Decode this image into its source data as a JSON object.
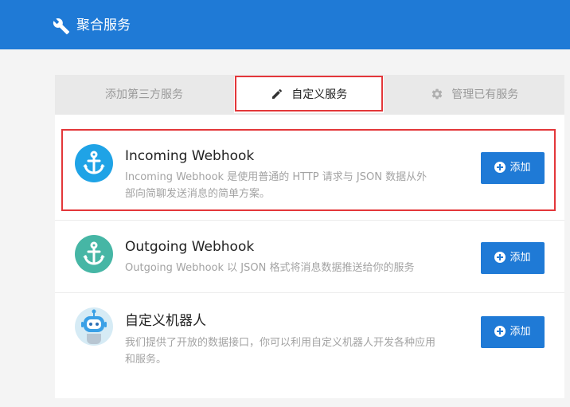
{
  "header": {
    "title": "聚合服务",
    "icon": "wrench-icon"
  },
  "tabs": [
    {
      "label": "添加第三方服务",
      "active": false
    },
    {
      "label": "自定义服务",
      "active": true,
      "icon": "pencil-icon"
    },
    {
      "label": "管理已有服务",
      "active": false,
      "icon": "gear-icon"
    }
  ],
  "services": [
    {
      "title": "Incoming Webhook",
      "description": "Incoming Webhook 是使用普通的 HTTP 请求与 JSON 数据从外部向简聊发送消息的简单方案。",
      "icon": "anchor-icon",
      "color": "#1fa3e6",
      "button": "添加"
    },
    {
      "title": "Outgoing Webhook",
      "description": "Outgoing Webhook 以 JSON 格式将消息数据推送给你的服务",
      "icon": "anchor-icon",
      "color": "#46b6a5",
      "button": "添加"
    },
    {
      "title": "自定义机器人",
      "description": "我们提供了开放的数据接口，你可以利用自定义机器人开发各种应用和服务。",
      "icon": "robot-icon",
      "color": "#d6ebf5",
      "button": "添加"
    }
  ],
  "colors": {
    "header": "#1f7ad6",
    "highlight": "#e3373a",
    "button": "#1f7ad6"
  }
}
